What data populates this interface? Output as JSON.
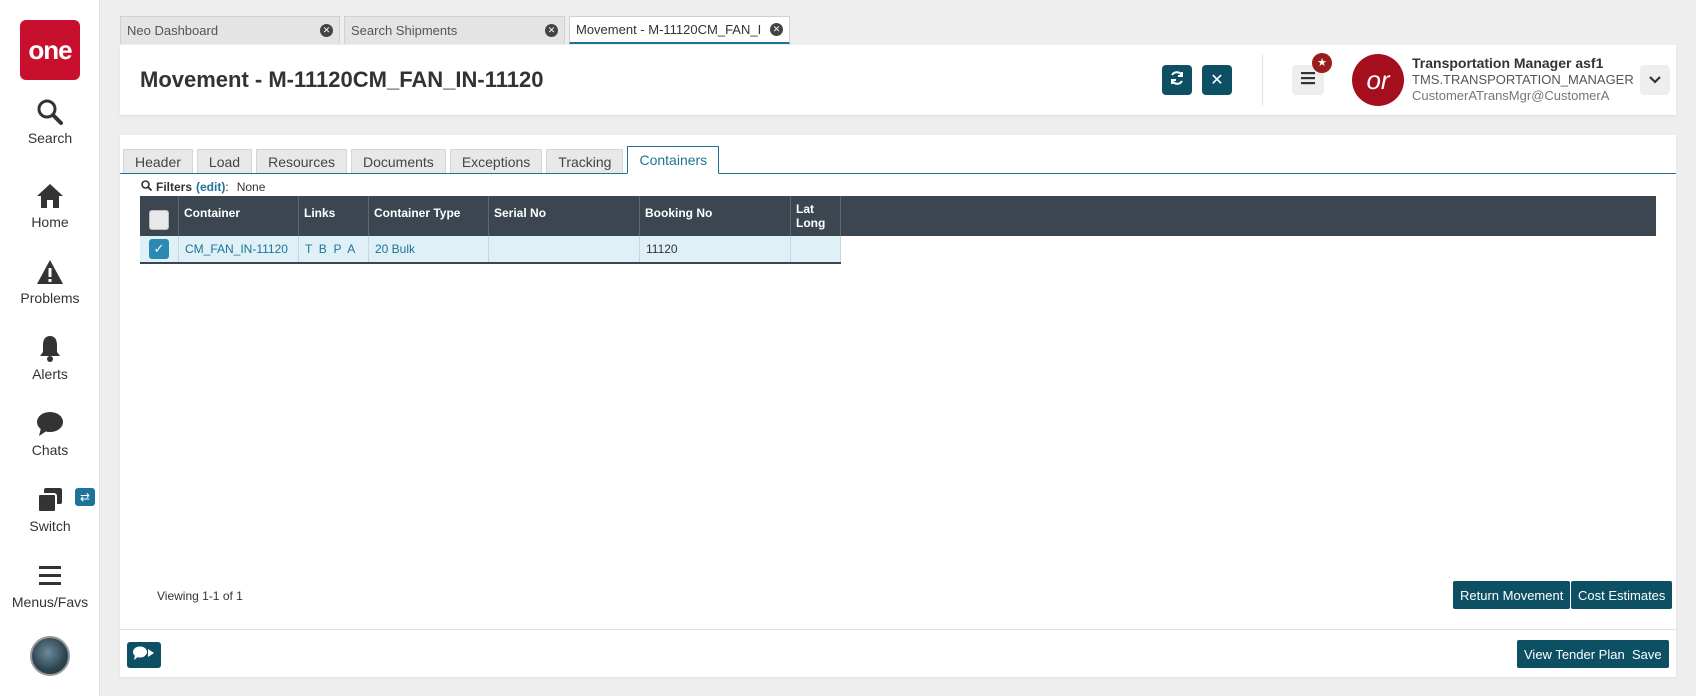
{
  "app": {
    "logo_text": "one",
    "brand_color": "#c8102e",
    "accent_color": "#0d5064",
    "link_color": "#1d7399"
  },
  "leftnav": {
    "items": [
      {
        "label": "Search",
        "icon": "search-icon"
      },
      {
        "label": "Home",
        "icon": "home-icon"
      },
      {
        "label": "Problems",
        "icon": "warning-icon"
      },
      {
        "label": "Alerts",
        "icon": "bell-icon"
      },
      {
        "label": "Chats",
        "icon": "chat-icon"
      },
      {
        "label": "Switch",
        "icon": "switch-icon"
      },
      {
        "label": "Menus/Favs",
        "icon": "hamburger-icon"
      }
    ],
    "switch_badge": "⇄"
  },
  "browser_tabs": [
    {
      "label": "Neo Dashboard",
      "active": false
    },
    {
      "label": "Search Shipments",
      "active": false
    },
    {
      "label": "Movement - M-11120CM_FAN_IN...",
      "active": true
    }
  ],
  "header": {
    "title": "Movement - M-11120CM_FAN_IN-11120",
    "refresh_icon": "refresh-icon",
    "close_icon": "close-icon",
    "notification_badge": "★",
    "user_initials": "or",
    "user_name": "Transportation Manager asf1",
    "user_role": "TMS.TRANSPORTATION_MANAGER",
    "user_email": "CustomerATransMgr@CustomerA"
  },
  "subtabs": [
    {
      "label": "Header"
    },
    {
      "label": "Load"
    },
    {
      "label": "Resources"
    },
    {
      "label": "Documents"
    },
    {
      "label": "Exceptions"
    },
    {
      "label": "Tracking"
    },
    {
      "label": "Containers"
    }
  ],
  "active_subtab": "Containers",
  "filters": {
    "label": "Filters",
    "edit_label": "(edit)",
    "colon": ":",
    "value": "None"
  },
  "grid": {
    "columns": [
      "Container",
      "Links",
      "Container Type",
      "Serial No",
      "Booking No",
      "Lat",
      "Long"
    ],
    "rows": [
      {
        "checked": true,
        "container": "CM_FAN_IN-11120",
        "links": "T  B  P  A",
        "container_type": "20 Bulk",
        "serial_no": "",
        "booking_no": "11120",
        "lat_long": ""
      }
    ]
  },
  "footer": {
    "viewing": "Viewing 1-1 of 1",
    "return_movement": "Return Movement",
    "cost_estimates": "Cost Estimates",
    "view_tender_plan": "View Tender Plan",
    "save": "Save"
  }
}
